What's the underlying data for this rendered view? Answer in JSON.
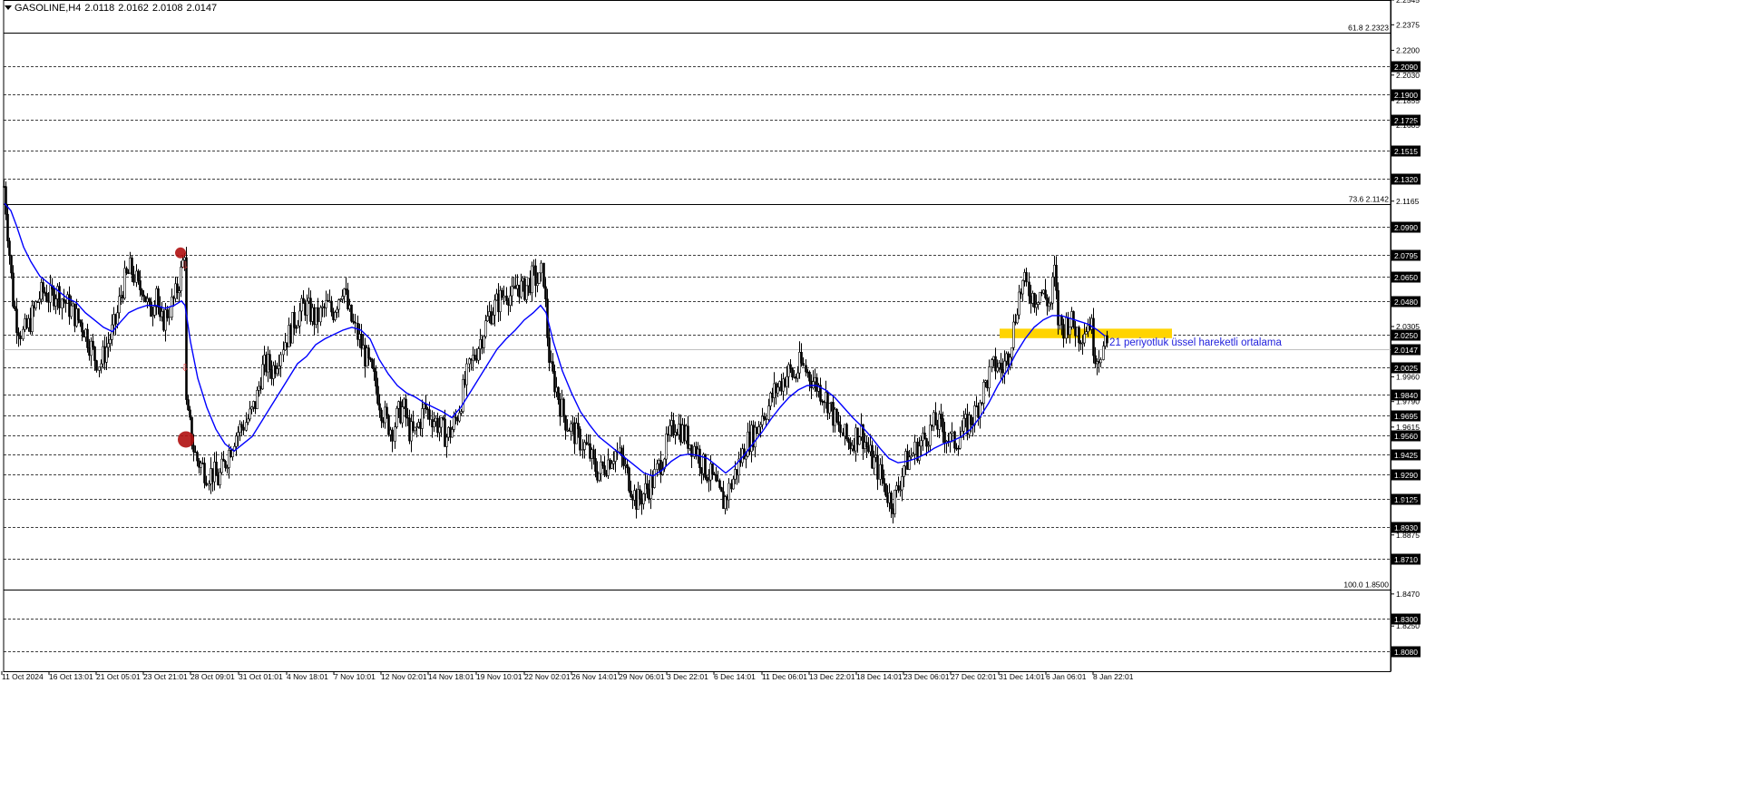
{
  "header": {
    "symbol": "GASOLINE,H4",
    "open": "2.0118",
    "high": "2.0162",
    "low": "2.0108",
    "close": "2.0147"
  },
  "annotation": {
    "ema_label": "21 periyotluk üssel hareketli ortalama"
  },
  "colors": {
    "ema_line": "#0000ff",
    "ema_text": "#2222dd",
    "zone_fill": "#ffd400",
    "signal_marker": "#b01010",
    "candles": "#000000",
    "grid": "#000000",
    "background": "#ffffff"
  },
  "chart_data": {
    "type": "candlestick",
    "y_range": [
      1.794,
      2.2545
    ],
    "price_scale_ticks": [
      "2.2545",
      "2.2375",
      "2.2200",
      "2.2030",
      "1.9960",
      "1.9790",
      "1.9615",
      "2.1855",
      "2.1685",
      "2.1165",
      "2.0305",
      "1.9100",
      "1.8875",
      "1.8470",
      "1.8250"
    ],
    "price_scale_ticks_values": [
      2.2545,
      2.2375,
      2.22,
      2.203,
      1.996,
      1.979,
      1.9615,
      2.1855,
      2.1685,
      2.1165,
      2.0305,
      1.91,
      1.8875,
      1.847,
      1.825
    ],
    "dashed_levels": [
      "2.2090",
      "2.1900",
      "2.1725",
      "2.1515",
      "2.1320",
      "2.0990",
      "2.0795",
      "2.0650",
      "2.0480",
      "2.0250",
      "2.0025",
      "1.9840",
      "1.9695",
      "1.9560",
      "1.9425",
      "1.9290",
      "1.9125",
      "1.8930",
      "1.8710",
      "1.8300",
      "1.8080"
    ],
    "dashed_levels_values": [
      2.209,
      2.19,
      2.1725,
      2.1515,
      2.132,
      2.099,
      2.0795,
      2.065,
      2.048,
      2.025,
      2.0025,
      1.984,
      1.9695,
      1.956,
      1.9425,
      1.929,
      1.9125,
      1.893,
      1.871,
      1.83,
      1.808
    ],
    "current_price": "2.0147",
    "current_price_value": 2.0147,
    "fibonacci_levels": [
      {
        "label": "61.8 2.2323",
        "value": 2.2323
      },
      {
        "label": "73.6 2.1142",
        "value": 2.1142
      },
      {
        "label": "100.0 1.8500",
        "value": 1.85
      }
    ],
    "x_labels": [
      "11 Oct 2024",
      "16 Oct 13:01",
      "21 Oct 05:01",
      "23 Oct 21:01",
      "28 Oct 09:01",
      "31 Oct 01:01",
      "4 Nov 18:01",
      "7 Nov 10:01",
      "12 Nov 02:01",
      "14 Nov 18:01",
      "19 Nov 10:01",
      "22 Nov 02:01",
      "26 Nov 14:01",
      "29 Nov 06:01",
      "3 Dec 22:01",
      "6 Dec 14:01",
      "11 Dec 06:01",
      "13 Dec 22:01",
      "18 Dec 14:01",
      "23 Dec 06:01",
      "27 Dec 02:01",
      "31 Dec 14:01",
      "6 Jan 06:01",
      "8 Jan 22:01"
    ],
    "price_path": [
      [
        0,
        2.165
      ],
      [
        2,
        2.14
      ],
      [
        5,
        2.12
      ],
      [
        9,
        2.09
      ],
      [
        14,
        2.05
      ],
      [
        18,
        2.035
      ],
      [
        24,
        2.025
      ],
      [
        30,
        2.03
      ],
      [
        36,
        2.04
      ],
      [
        42,
        2.05
      ],
      [
        48,
        2.055
      ],
      [
        55,
        2.05
      ],
      [
        62,
        2.055
      ],
      [
        68,
        2.05
      ],
      [
        74,
        2.045
      ],
      [
        80,
        2.04
      ],
      [
        86,
        2.035
      ],
      [
        92,
        2.03
      ],
      [
        98,
        2.02
      ],
      [
        104,
        2.01
      ],
      [
        110,
        2.005
      ],
      [
        116,
        2.015
      ],
      [
        122,
        2.025
      ],
      [
        128,
        2.035
      ],
      [
        132,
        2.05
      ],
      [
        136,
        2.06
      ],
      [
        140,
        2.065
      ],
      [
        144,
        2.07
      ],
      [
        148,
        2.065
      ],
      [
        152,
        2.055
      ],
      [
        156,
        2.06
      ],
      [
        160,
        2.05
      ],
      [
        164,
        2.04
      ],
      [
        168,
        2.045
      ],
      [
        172,
        2.06
      ],
      [
        176,
        2.03
      ],
      [
        180,
        2.035
      ],
      [
        184,
        2.04
      ],
      [
        188,
        2.045
      ],
      [
        192,
        2.05
      ],
      [
        196,
        2.06
      ],
      [
        200,
        2.07
      ],
      [
        203,
        2.085
      ],
      [
        205,
        1.97
      ],
      [
        208,
        1.965
      ],
      [
        212,
        1.95
      ],
      [
        216,
        1.94
      ],
      [
        222,
        1.935
      ],
      [
        228,
        1.93
      ],
      [
        234,
        1.93
      ],
      [
        240,
        1.925
      ],
      [
        246,
        1.935
      ],
      [
        252,
        1.945
      ],
      [
        258,
        1.955
      ],
      [
        264,
        1.96
      ],
      [
        270,
        1.965
      ],
      [
        276,
        1.97
      ],
      [
        282,
        1.98
      ],
      [
        288,
        2.0
      ],
      [
        294,
        2.005
      ],
      [
        300,
        2.0
      ],
      [
        306,
        2.01
      ],
      [
        312,
        2.02
      ],
      [
        318,
        2.025
      ],
      [
        324,
        2.035
      ],
      [
        330,
        2.04
      ],
      [
        336,
        2.045
      ],
      [
        342,
        2.04
      ],
      [
        348,
        2.035
      ],
      [
        354,
        2.04
      ],
      [
        360,
        2.045
      ],
      [
        366,
        2.04
      ],
      [
        372,
        2.05
      ],
      [
        378,
        2.06
      ],
      [
        384,
        2.04
      ],
      [
        390,
        2.03
      ],
      [
        396,
        2.02
      ],
      [
        402,
        2.01
      ],
      [
        408,
        2.0
      ],
      [
        414,
        1.99
      ],
      [
        420,
        1.975
      ],
      [
        426,
        1.965
      ],
      [
        432,
        1.96
      ],
      [
        438,
        1.97
      ],
      [
        444,
        1.975
      ],
      [
        450,
        1.96
      ],
      [
        456,
        1.955
      ],
      [
        462,
        1.965
      ],
      [
        468,
        1.975
      ],
      [
        474,
        1.97
      ],
      [
        480,
        1.965
      ],
      [
        486,
        1.96
      ],
      [
        492,
        1.955
      ],
      [
        498,
        1.96
      ],
      [
        504,
        1.97
      ],
      [
        510,
        1.985
      ],
      [
        516,
        2.0
      ],
      [
        522,
        2.01
      ],
      [
        528,
        2.02
      ],
      [
        534,
        2.03
      ],
      [
        540,
        2.04
      ],
      [
        546,
        2.045
      ],
      [
        552,
        2.05
      ],
      [
        558,
        2.055
      ],
      [
        564,
        2.05
      ],
      [
        570,
        2.06
      ],
      [
        576,
        2.055
      ],
      [
        582,
        2.06
      ],
      [
        588,
        2.065
      ],
      [
        594,
        2.06
      ],
      [
        598,
        2.07
      ],
      [
        602,
        2.03
      ],
      [
        606,
        2.0
      ],
      [
        612,
        1.99
      ],
      [
        618,
        1.975
      ],
      [
        624,
        1.965
      ],
      [
        630,
        1.96
      ],
      [
        636,
        1.955
      ],
      [
        642,
        1.95
      ],
      [
        648,
        1.945
      ],
      [
        654,
        1.935
      ],
      [
        660,
        1.93
      ],
      [
        666,
        1.935
      ],
      [
        672,
        1.94
      ],
      [
        678,
        1.945
      ],
      [
        684,
        1.94
      ],
      [
        690,
        1.93
      ],
      [
        696,
        1.92
      ],
      [
        702,
        1.91
      ],
      [
        708,
        1.915
      ],
      [
        714,
        1.92
      ],
      [
        720,
        1.925
      ],
      [
        726,
        1.935
      ],
      [
        732,
        1.945
      ],
      [
        738,
        1.955
      ],
      [
        744,
        1.965
      ],
      [
        750,
        1.96
      ],
      [
        756,
        1.955
      ],
      [
        762,
        1.95
      ],
      [
        768,
        1.945
      ],
      [
        774,
        1.935
      ],
      [
        780,
        1.93
      ],
      [
        786,
        1.925
      ],
      [
        792,
        1.915
      ],
      [
        798,
        1.91
      ],
      [
        804,
        1.92
      ],
      [
        810,
        1.93
      ],
      [
        816,
        1.94
      ],
      [
        822,
        1.95
      ],
      [
        828,
        1.955
      ],
      [
        834,
        1.96
      ],
      [
        840,
        1.97
      ],
      [
        846,
        1.975
      ],
      [
        852,
        1.985
      ],
      [
        858,
        1.99
      ],
      [
        864,
        1.995
      ],
      [
        870,
        2.0
      ],
      [
        876,
        1.995
      ],
      [
        882,
        2.005
      ],
      [
        888,
        2.0
      ],
      [
        894,
        1.995
      ],
      [
        900,
        1.99
      ],
      [
        906,
        1.985
      ],
      [
        912,
        1.98
      ],
      [
        918,
        1.97
      ],
      [
        924,
        1.96
      ],
      [
        930,
        1.955
      ],
      [
        936,
        1.95
      ],
      [
        942,
        1.955
      ],
      [
        948,
        1.96
      ],
      [
        954,
        1.95
      ],
      [
        960,
        1.94
      ],
      [
        966,
        1.935
      ],
      [
        972,
        1.925
      ],
      [
        978,
        1.915
      ],
      [
        984,
        1.91
      ],
      [
        990,
        1.92
      ],
      [
        996,
        1.935
      ],
      [
        1002,
        1.94
      ],
      [
        1008,
        1.945
      ],
      [
        1014,
        1.95
      ],
      [
        1020,
        1.955
      ],
      [
        1026,
        1.96
      ],
      [
        1032,
        1.965
      ],
      [
        1038,
        1.96
      ],
      [
        1044,
        1.955
      ],
      [
        1050,
        1.95
      ],
      [
        1056,
        1.955
      ],
      [
        1062,
        1.96
      ],
      [
        1068,
        1.965
      ],
      [
        1074,
        1.97
      ],
      [
        1080,
        1.98
      ],
      [
        1086,
        1.99
      ],
      [
        1092,
        2.0
      ],
      [
        1098,
        2.005
      ],
      [
        1104,
        2.0
      ],
      [
        1110,
        2.01
      ],
      [
        1116,
        2.025
      ],
      [
        1122,
        2.05
      ],
      [
        1128,
        2.06
      ],
      [
        1134,
        2.055
      ],
      [
        1140,
        2.05
      ],
      [
        1146,
        2.055
      ],
      [
        1152,
        2.05
      ],
      [
        1158,
        2.045
      ],
      [
        1162,
        2.07
      ],
      [
        1166,
        2.035
      ],
      [
        1172,
        2.03
      ],
      [
        1178,
        2.035
      ],
      [
        1184,
        2.03
      ],
      [
        1190,
        2.025
      ],
      [
        1196,
        2.03
      ],
      [
        1202,
        2.035
      ],
      [
        1206,
        2.015
      ],
      [
        1210,
        2.01
      ],
      [
        1214,
        2.015
      ],
      [
        1218,
        2.0155
      ]
    ],
    "ema_path": [
      [
        5,
        2.115
      ],
      [
        12,
        2.11
      ],
      [
        18,
        2.1
      ],
      [
        26,
        2.085
      ],
      [
        34,
        2.075
      ],
      [
        44,
        2.065
      ],
      [
        54,
        2.06
      ],
      [
        64,
        2.055
      ],
      [
        74,
        2.05
      ],
      [
        84,
        2.047
      ],
      [
        94,
        2.04
      ],
      [
        104,
        2.035
      ],
      [
        114,
        2.03
      ],
      [
        124,
        2.027
      ],
      [
        132,
        2.033
      ],
      [
        142,
        2.04
      ],
      [
        152,
        2.043
      ],
      [
        162,
        2.045
      ],
      [
        172,
        2.045
      ],
      [
        182,
        2.043
      ],
      [
        192,
        2.045
      ],
      [
        200,
        2.048
      ],
      [
        204,
        2.045
      ],
      [
        210,
        2.02
      ],
      [
        218,
        1.995
      ],
      [
        228,
        1.975
      ],
      [
        238,
        1.96
      ],
      [
        248,
        1.95
      ],
      [
        258,
        1.945
      ],
      [
        268,
        1.95
      ],
      [
        278,
        1.955
      ],
      [
        288,
        1.965
      ],
      [
        298,
        1.975
      ],
      [
        308,
        1.985
      ],
      [
        318,
        1.995
      ],
      [
        328,
        2.005
      ],
      [
        338,
        2.01
      ],
      [
        348,
        2.018
      ],
      [
        358,
        2.022
      ],
      [
        368,
        2.025
      ],
      [
        378,
        2.028
      ],
      [
        388,
        2.03
      ],
      [
        398,
        2.028
      ],
      [
        408,
        2.022
      ],
      [
        418,
        2.008
      ],
      [
        428,
        1.998
      ],
      [
        438,
        1.99
      ],
      [
        448,
        1.985
      ],
      [
        458,
        1.982
      ],
      [
        468,
        1.978
      ],
      [
        478,
        1.975
      ],
      [
        488,
        1.972
      ],
      [
        498,
        1.968
      ],
      [
        508,
        1.975
      ],
      [
        518,
        1.985
      ],
      [
        528,
        1.995
      ],
      [
        538,
        2.005
      ],
      [
        548,
        2.015
      ],
      [
        558,
        2.022
      ],
      [
        568,
        2.028
      ],
      [
        578,
        2.035
      ],
      [
        588,
        2.04
      ],
      [
        596,
        2.045
      ],
      [
        602,
        2.04
      ],
      [
        610,
        2.02
      ],
      [
        620,
        2.0
      ],
      [
        630,
        1.985
      ],
      [
        640,
        1.972
      ],
      [
        650,
        1.963
      ],
      [
        660,
        1.955
      ],
      [
        670,
        1.95
      ],
      [
        680,
        1.945
      ],
      [
        690,
        1.94
      ],
      [
        700,
        1.935
      ],
      [
        710,
        1.93
      ],
      [
        720,
        1.928
      ],
      [
        730,
        1.932
      ],
      [
        740,
        1.938
      ],
      [
        750,
        1.942
      ],
      [
        760,
        1.943
      ],
      [
        770,
        1.942
      ],
      [
        780,
        1.94
      ],
      [
        790,
        1.935
      ],
      [
        800,
        1.93
      ],
      [
        810,
        1.935
      ],
      [
        820,
        1.942
      ],
      [
        830,
        1.95
      ],
      [
        840,
        1.958
      ],
      [
        850,
        1.967
      ],
      [
        860,
        1.975
      ],
      [
        870,
        1.982
      ],
      [
        880,
        1.987
      ],
      [
        890,
        1.99
      ],
      [
        900,
        1.99
      ],
      [
        910,
        1.987
      ],
      [
        920,
        1.982
      ],
      [
        930,
        1.975
      ],
      [
        940,
        1.968
      ],
      [
        950,
        1.962
      ],
      [
        960,
        1.955
      ],
      [
        970,
        1.947
      ],
      [
        980,
        1.94
      ],
      [
        990,
        1.937
      ],
      [
        1000,
        1.938
      ],
      [
        1010,
        1.94
      ],
      [
        1020,
        1.943
      ],
      [
        1030,
        1.947
      ],
      [
        1040,
        1.95
      ],
      [
        1050,
        1.952
      ],
      [
        1060,
        1.955
      ],
      [
        1070,
        1.96
      ],
      [
        1080,
        1.968
      ],
      [
        1090,
        1.978
      ],
      [
        1100,
        1.99
      ],
      [
        1110,
        2.0
      ],
      [
        1120,
        2.012
      ],
      [
        1130,
        2.022
      ],
      [
        1140,
        2.03
      ],
      [
        1150,
        2.035
      ],
      [
        1160,
        2.038
      ],
      [
        1170,
        2.038
      ],
      [
        1180,
        2.036
      ],
      [
        1190,
        2.034
      ],
      [
        1200,
        2.032
      ],
      [
        1210,
        2.028
      ],
      [
        1218,
        2.024
      ]
    ],
    "signals": [
      {
        "kind": "dot",
        "at": 199,
        "price": 2.081,
        "r": 6
      },
      {
        "kind": "dot",
        "at": 205,
        "price": 1.953,
        "r": 9
      },
      {
        "kind": "arrow",
        "at": 204,
        "price": 2.07
      },
      {
        "kind": "arrow",
        "at": 204,
        "price": 2.0
      }
    ],
    "zone": {
      "from": 1102,
      "to": 1292,
      "top": 2.029,
      "bottom": 2.0225
    }
  }
}
